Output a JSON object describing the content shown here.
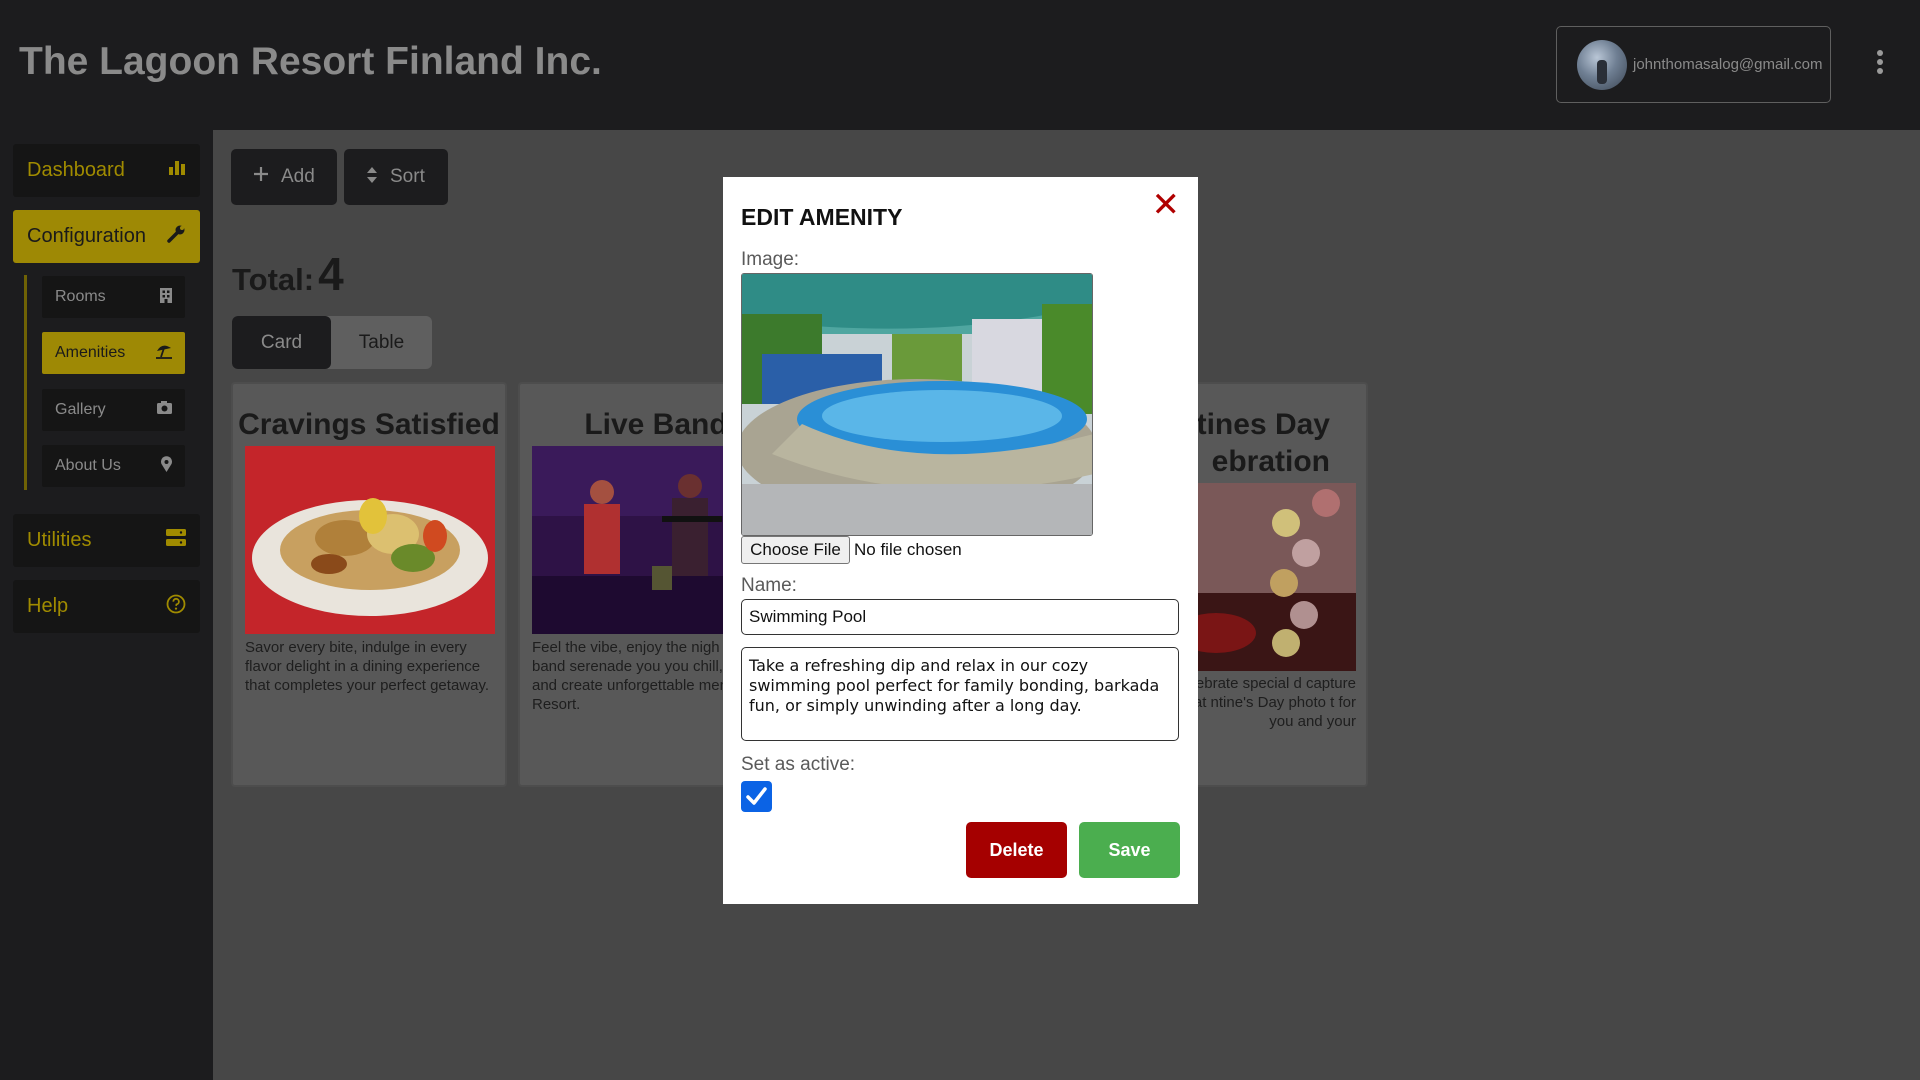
{
  "header": {
    "title": "The Lagoon Resort Finland Inc.",
    "user_email": "johnthomasalog@gmail.com"
  },
  "sidebar": {
    "items": [
      {
        "label": "Dashboard",
        "icon": "bar-chart-icon"
      },
      {
        "label": "Configuration",
        "icon": "wrench-icon"
      },
      {
        "label": "Utilities",
        "icon": "database-icon"
      },
      {
        "label": "Help",
        "icon": "question-circle-icon"
      }
    ],
    "sub_items": [
      {
        "label": "Rooms",
        "icon": "building-icon"
      },
      {
        "label": "Amenities",
        "icon": "umbrella-beach-icon"
      },
      {
        "label": "Gallery",
        "icon": "camera-icon"
      },
      {
        "label": "About Us",
        "icon": "map-pin-icon"
      }
    ]
  },
  "toolbar": {
    "add_label": "Add",
    "sort_label": "Sort"
  },
  "summary": {
    "total_label": "Total:",
    "total_count": "4"
  },
  "view_tabs": {
    "card": "Card",
    "table": "Table"
  },
  "cards": [
    {
      "title": "Cravings Satisfied",
      "description": "Savor every bite, indulge in every flavor delight in a dining experience that completes your perfect getaway."
    },
    {
      "title": "Live Band",
      "description": "Feel the vibe, enjoy the nigh our live band serenade you you chill, dine, and create unforgettable memories at Resort."
    },
    {
      "title": "ntines Day ebration",
      "description": "air! Celebrate special d capture memories at ntine's Day photo t for you and your"
    }
  ],
  "modal": {
    "title": "EDIT AMENITY",
    "close_icon": "close-icon",
    "image_label": "Image:",
    "file_button": "Choose File",
    "file_status": "No file chosen",
    "name_label": "Name:",
    "name_value": "Swimming Pool",
    "description_value": "Take a refreshing dip and relax in our cozy swimming pool perfect for family bonding, barkada fun, or simply unwinding after a long day.",
    "active_label": "Set as active:",
    "active_checked": true,
    "delete_label": "Delete",
    "save_label": "Save"
  },
  "colors": {
    "accent": "#9e8905",
    "delete": "#a50000",
    "save": "#4bae4f",
    "checkbox": "#0b63e5"
  }
}
